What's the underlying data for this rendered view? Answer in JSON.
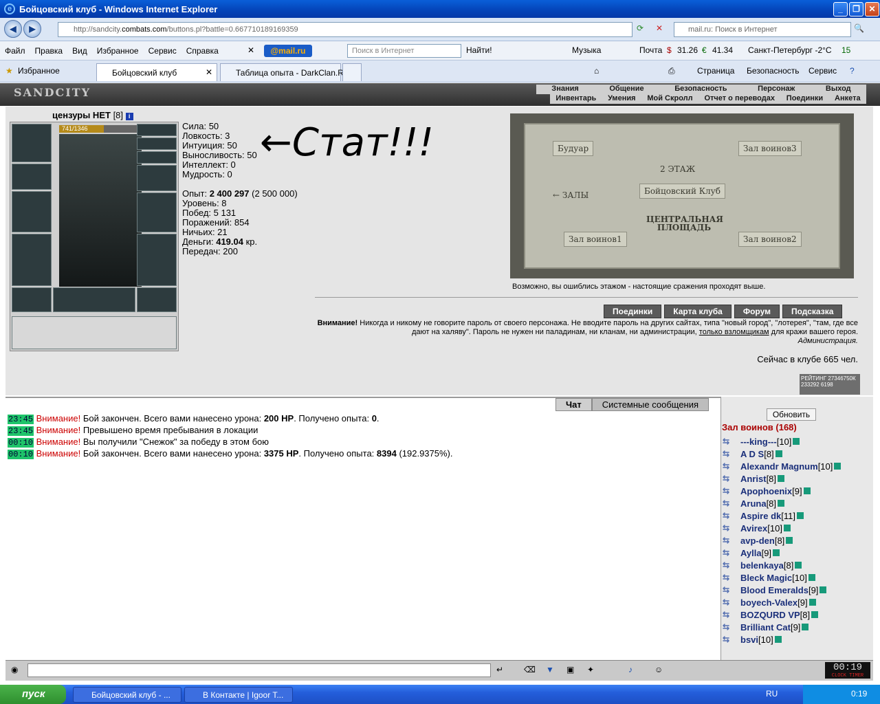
{
  "window": {
    "title": "Бойцовский клуб - Windows Internet Explorer"
  },
  "address": {
    "prefix": "http://sandcity.",
    "domain": "combats.com",
    "path": "/buttons.pl?battle=0.667710189169359",
    "search_placeholder": "mail.ru: Поиск в Интернет"
  },
  "menu": [
    "Файл",
    "Правка",
    "Вид",
    "Избранное",
    "Сервис",
    "Справка"
  ],
  "toolbar": {
    "mail_logo": "@mail.ru",
    "search_placeholder": "Поиск в Интернет",
    "find_label": "Найти!",
    "music": "Музыка",
    "mail": "Почта",
    "usd": "31.26",
    "eur": "41.34",
    "weather": "Санкт-Петербург -2°С",
    "count": "15"
  },
  "tabs": {
    "favorites": "Избранное",
    "tab1": "Бойцовский клуб",
    "tab2": "Таблица опыта - DarkClan.Ru"
  },
  "cmd": {
    "page": "Страница",
    "security": "Безопасность",
    "service": "Сервис"
  },
  "game": {
    "logo": "SANDCITY",
    "toplinks": [
      "Знания",
      "Общение",
      "Безопасность",
      "Персонаж",
      "Выход"
    ],
    "sublinks": [
      "Инвентарь",
      "Умения",
      "Мой Скролл",
      "Отчет о переводах",
      "Поединки",
      "Анкета"
    ],
    "char_name": "цензуры НЕТ",
    "char_level": "[8]",
    "hp": "741/1346",
    "hp_ratio": 0.55,
    "stats": [
      "Сила: 50",
      "Ловкость: 3",
      "Интуиция: 50",
      "Выносливость: 50",
      "Интеллект: 0",
      "Мудрость: 0"
    ],
    "exp_label": "Опыт: ",
    "exp": "2 400 297",
    "exp_next": "(2 500 000)",
    "level": "Уровень: 8",
    "wins": "Побед: 5 131",
    "losses": "Поражений: 854",
    "draws": "Ничьих: 21",
    "money_label": "Деньги: ",
    "money": "419.04",
    "money_unit": " кр.",
    "transfers": "Передач: 200",
    "scribble": "←Стат!!!",
    "map": {
      "floor": "2 ЭТАЖ",
      "boudoir": "Будуар",
      "hall3": "Зал воинов3",
      "halls": "← ЗАЛЫ",
      "club": "Бойцовский Клуб",
      "square": "ЦЕНТРАЛЬНАЯ ПЛОЩАДЬ",
      "hall1": "Зал воинов1",
      "hall2": "Зал воинов2"
    },
    "map_msg": "Возможно, вы ошиблись этажом - настоящие сражения проходят выше.",
    "buttons": [
      "Поединки",
      "Карта клуба",
      "Форум",
      "Подсказка"
    ],
    "warn_title": "Внимание!",
    "warn_text": " Никогда и никому не говорите пароль от своего персонажа. Не вводите пароль на других сайтах, типа \"новый город\", \"лотерея\", \"там, где все дают на халяву\". Пароль не нужен ни паладинам, ни кланам, ни администрации, ",
    "warn_link": "только взломщикам",
    "warn_end": " для кражи вашего героя.",
    "warn_sign": "Администрация.",
    "online": "Сейчас в клубе 665 чел.",
    "rating": "РЕЙТИНГ 27346750К 233292 6198"
  },
  "chat": {
    "tabs": [
      "Чат",
      "Системные сообщения"
    ],
    "lines": [
      {
        "time": "23:45",
        "warn": "Внимание!",
        "text": " Бой закончен. Всего вами нанесено урона: ",
        "b1": "200 HP",
        "t2": ". Получено опыта: ",
        "b2": "0",
        "t3": "."
      },
      {
        "time": "23:45",
        "warn": "Внимание!",
        "text": " Превышено время пребывания в локации"
      },
      {
        "time": "00:10",
        "warn": "Внимание!",
        "text": " Вы получили \"Снежок\" за победу в этом бою"
      },
      {
        "time": "00:10",
        "warn": "Внимание!",
        "text": " Бой закончен. Всего вами нанесено урона: ",
        "b1": "3375 HP",
        "t2": ". Получено опыта: ",
        "b2": "8394",
        "t3": " (192.9375%)."
      }
    ]
  },
  "room": {
    "refresh": "Обновить",
    "hall": "Зал воинов (168)",
    "users": [
      {
        "name": "---king---",
        "lvl": "[10]"
      },
      {
        "name": "A D S",
        "lvl": "[8]"
      },
      {
        "name": "Alexandr Magnum",
        "lvl": "[10]"
      },
      {
        "name": "Anrist",
        "lvl": "[8]"
      },
      {
        "name": "Apophoenix",
        "lvl": "[9]"
      },
      {
        "name": "Aruna",
        "lvl": "[8]"
      },
      {
        "name": "Aspire dk",
        "lvl": "[11]"
      },
      {
        "name": "Avirex",
        "lvl": "[10]"
      },
      {
        "name": "avp-den",
        "lvl": "[8]"
      },
      {
        "name": "Aylla",
        "lvl": "[9]"
      },
      {
        "name": "belenkaya",
        "lvl": "[8]"
      },
      {
        "name": "Bleck Magic",
        "lvl": "[10]"
      },
      {
        "name": "Blood Emeralds",
        "lvl": "[9]"
      },
      {
        "name": "boyech-Valex",
        "lvl": "[9]"
      },
      {
        "name": "BOZQURD VP",
        "lvl": "[8]"
      },
      {
        "name": "Brilliant Cat",
        "lvl": "[9]"
      },
      {
        "name": "bsvi",
        "lvl": "[10]"
      }
    ]
  },
  "clock": {
    "time": "00:19",
    "label": "CLOCK TIMER"
  },
  "taskbar": {
    "start": "пуск",
    "task1": "Бойцовский клуб - ...",
    "task2": "В Контакте | Igoor T...",
    "lang": "RU",
    "time": "0:19"
  }
}
